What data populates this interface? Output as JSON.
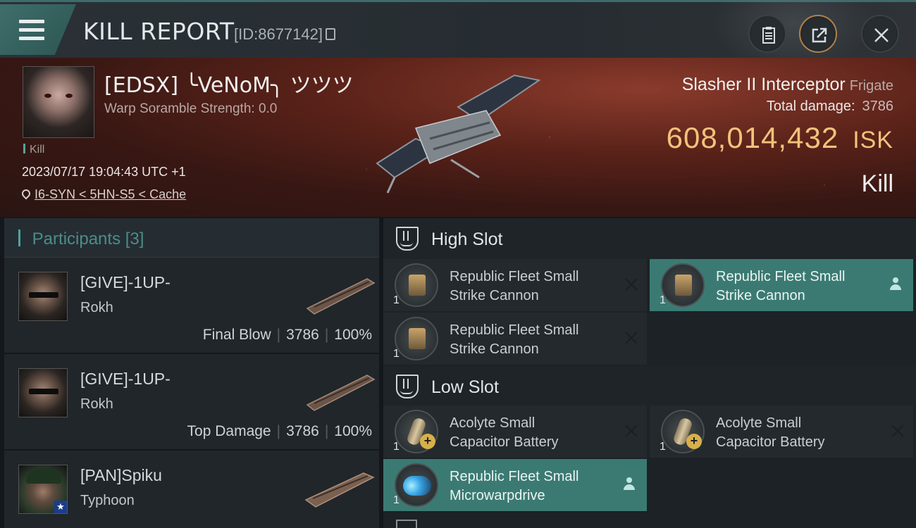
{
  "header": {
    "title": "KILL REPORT",
    "report_id": "[ID:8677142]",
    "icons": [
      "menu-icon",
      "clipboard-icon",
      "share-icon",
      "close-icon"
    ]
  },
  "victim": {
    "name": "[EDSX] ╰VeNoM╮ ツツツ",
    "warp_scramble": "Warp Soramble Strength: 0.0",
    "tag": "Kill",
    "datetime": "2023/07/17 19:04:43 UTC +1",
    "location": "I6-SYN < 5HN-S5 < Cache",
    "ship": "Slasher II Interceptor",
    "ship_class": "Frigate",
    "total_damage_label": "Total damage:",
    "total_damage": "3786",
    "isk_value": "608,014,432",
    "isk_unit": "ISK",
    "result": "Kill"
  },
  "participants": {
    "header": "Participants",
    "count": "[3]",
    "rows": [
      {
        "name": "[GIVE]-1UP-",
        "ship": "Rokh",
        "role": "Final Blow",
        "damage": "3786",
        "percent": "100%"
      },
      {
        "name": "[GIVE]-1UP-",
        "ship": "Rokh",
        "role": "Top Damage",
        "damage": "3786",
        "percent": "100%"
      },
      {
        "name": "[PAN]Spiku",
        "ship": "Typhoon"
      }
    ]
  },
  "fitting": {
    "high_slot": {
      "title": "High Slot",
      "modules": [
        {
          "qty": "1",
          "line1": "Republic Fleet Small",
          "line2": "Strike Cannon",
          "status": "destroyed"
        },
        {
          "qty": "1",
          "line1": "Republic Fleet Small",
          "line2": "Strike Cannon",
          "status": "dropped"
        },
        {
          "qty": "1",
          "line1": "Republic Fleet Small",
          "line2": "Strike Cannon",
          "status": "destroyed"
        }
      ]
    },
    "low_slot": {
      "title": "Low Slot",
      "modules": [
        {
          "qty": "1",
          "line1": "Acolyte Small",
          "line2": "Capacitor Battery",
          "status": "destroyed"
        },
        {
          "qty": "1",
          "line1": "Acolyte Small",
          "line2": "Capacitor Battery",
          "status": "destroyed"
        },
        {
          "qty": "1",
          "line1": "Republic Fleet Small",
          "line2": "Microwarpdrive",
          "status": "dropped"
        }
      ]
    }
  },
  "colors": {
    "accent_teal": "#3b7a72",
    "isk_gold": "#f2c27b",
    "banner_red": "#5a2219"
  }
}
